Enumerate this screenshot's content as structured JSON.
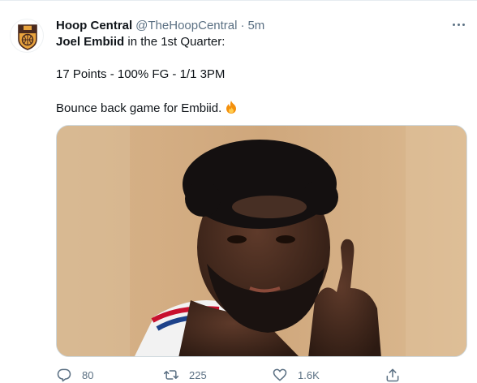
{
  "tweet": {
    "display_name": "Hoop Central",
    "handle": "@TheHoopCentral",
    "separator": "·",
    "time": "5m",
    "line1_bold": "Joel Embiid",
    "line1_rest": " in the 1st Quarter:",
    "line2": "17 Points - 100% FG - 1/1 3PM",
    "line3": "Bounce back game for Embiid.",
    "emoji": "fire-emoji",
    "media_alt": "Joel Embiid gesturing with one finger raised"
  },
  "actions": {
    "reply_count": "80",
    "retweet_count": "225",
    "like_count": "1.6K"
  },
  "colors": {
    "text": "#0f1419",
    "secondary": "#5b7083",
    "border": "#cfd9de",
    "fire": "#f4900c"
  },
  "icons": {
    "more": "more-icon",
    "reply": "reply-icon",
    "retweet": "retweet-icon",
    "like": "like-icon",
    "share": "share-icon",
    "avatar": "hoop-central-logo"
  }
}
